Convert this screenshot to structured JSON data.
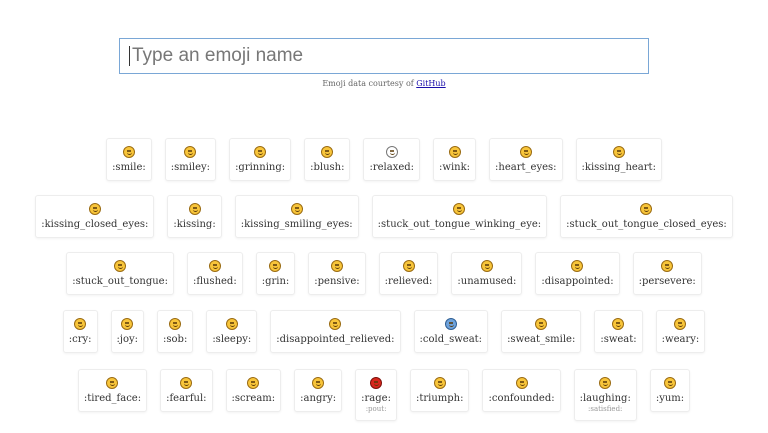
{
  "search": {
    "placeholder": "Type an emoji name",
    "value": ""
  },
  "credit": {
    "text": "Emoji data courtesy of ",
    "link": "GitHub"
  },
  "rows": [
    [
      {
        "label": ":smile:"
      },
      {
        "label": ":smiley:"
      },
      {
        "label": ":grinning:"
      },
      {
        "label": ":blush:"
      },
      {
        "label": ":relaxed:",
        "style": "plain"
      },
      {
        "label": ":wink:"
      },
      {
        "label": ":heart_eyes:"
      },
      {
        "label": ":kissing_heart:"
      }
    ],
    [
      {
        "label": ":kissing_closed_eyes:"
      },
      {
        "label": ":kissing:"
      },
      {
        "label": ":kissing_smiling_eyes:"
      },
      {
        "label": ":stuck_out_tongue_winking_eye:"
      },
      {
        "label": ":stuck_out_tongue_closed_eyes:"
      }
    ],
    [
      {
        "label": ":stuck_out_tongue:"
      },
      {
        "label": ":flushed:"
      },
      {
        "label": ":grin:"
      },
      {
        "label": ":pensive:"
      },
      {
        "label": ":relieved:"
      },
      {
        "label": ":unamused:"
      },
      {
        "label": ":disappointed:"
      },
      {
        "label": ":persevere:"
      }
    ],
    [
      {
        "label": ":cry:"
      },
      {
        "label": ":joy:"
      },
      {
        "label": ":sob:"
      },
      {
        "label": ":sleepy:"
      },
      {
        "label": ":disappointed_relieved:"
      },
      {
        "label": ":cold_sweat:",
        "style": "blue"
      },
      {
        "label": ":sweat_smile:"
      },
      {
        "label": ":sweat:"
      },
      {
        "label": ":weary:"
      }
    ],
    [
      {
        "label": ":tired_face:"
      },
      {
        "label": ":fearful:"
      },
      {
        "label": ":scream:"
      },
      {
        "label": ":angry:"
      },
      {
        "label": ":rage:",
        "alias": ":pout:",
        "style": "red"
      },
      {
        "label": ":triumph:"
      },
      {
        "label": ":confounded:"
      },
      {
        "label": ":laughing:",
        "alias": ":satisfied:"
      },
      {
        "label": ":yum:"
      }
    ]
  ],
  "colors": {
    "accent": "#7aa7d6",
    "link": "#1a0dab",
    "emoji": "#f8c53a",
    "rage": "#d8261c",
    "cold_sweat": "#6fa3dc"
  }
}
